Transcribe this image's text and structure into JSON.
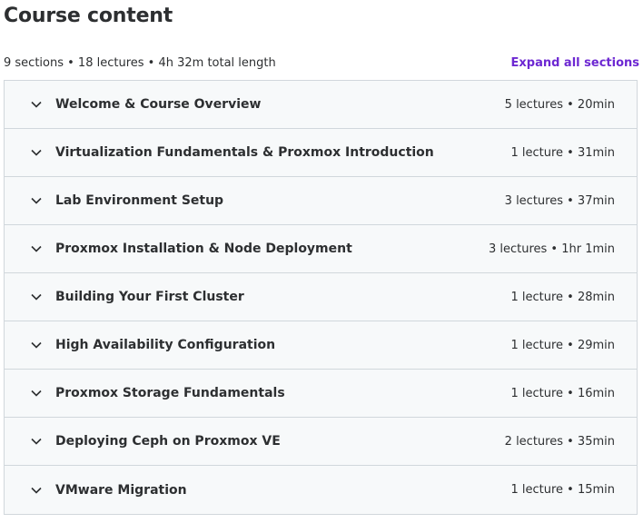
{
  "header": {
    "title": "Course content",
    "summary": "9 sections • 18 lectures • 4h 32m total length",
    "expand_all_label": "Expand all sections"
  },
  "colors": {
    "accent": "#6d28d2",
    "section_bg": "#f7f9fa",
    "border": "#d1d7dc",
    "text": "#2d2f31"
  },
  "sections": [
    {
      "title": "Welcome & Course Overview",
      "meta": "5 lectures • 20min",
      "icon": "chevron-down-icon"
    },
    {
      "title": "Virtualization Fundamentals & Proxmox Introduction",
      "meta": "1 lecture • 31min",
      "icon": "chevron-down-icon"
    },
    {
      "title": "Lab Environment Setup",
      "meta": "3 lectures • 37min",
      "icon": "chevron-down-icon"
    },
    {
      "title": "Proxmox Installation & Node Deployment",
      "meta": "3 lectures • 1hr 1min",
      "icon": "chevron-down-icon"
    },
    {
      "title": "Building Your First Cluster",
      "meta": "1 lecture • 28min",
      "icon": "chevron-down-icon"
    },
    {
      "title": "High Availability Configuration",
      "meta": "1 lecture • 29min",
      "icon": "chevron-down-icon"
    },
    {
      "title": "Proxmox Storage Fundamentals",
      "meta": "1 lecture • 16min",
      "icon": "chevron-down-icon"
    },
    {
      "title": "Deploying Ceph on Proxmox VE",
      "meta": "2 lectures • 35min",
      "icon": "chevron-down-icon"
    },
    {
      "title": "VMware Migration",
      "meta": "1 lecture • 15min",
      "icon": "chevron-down-icon"
    }
  ]
}
